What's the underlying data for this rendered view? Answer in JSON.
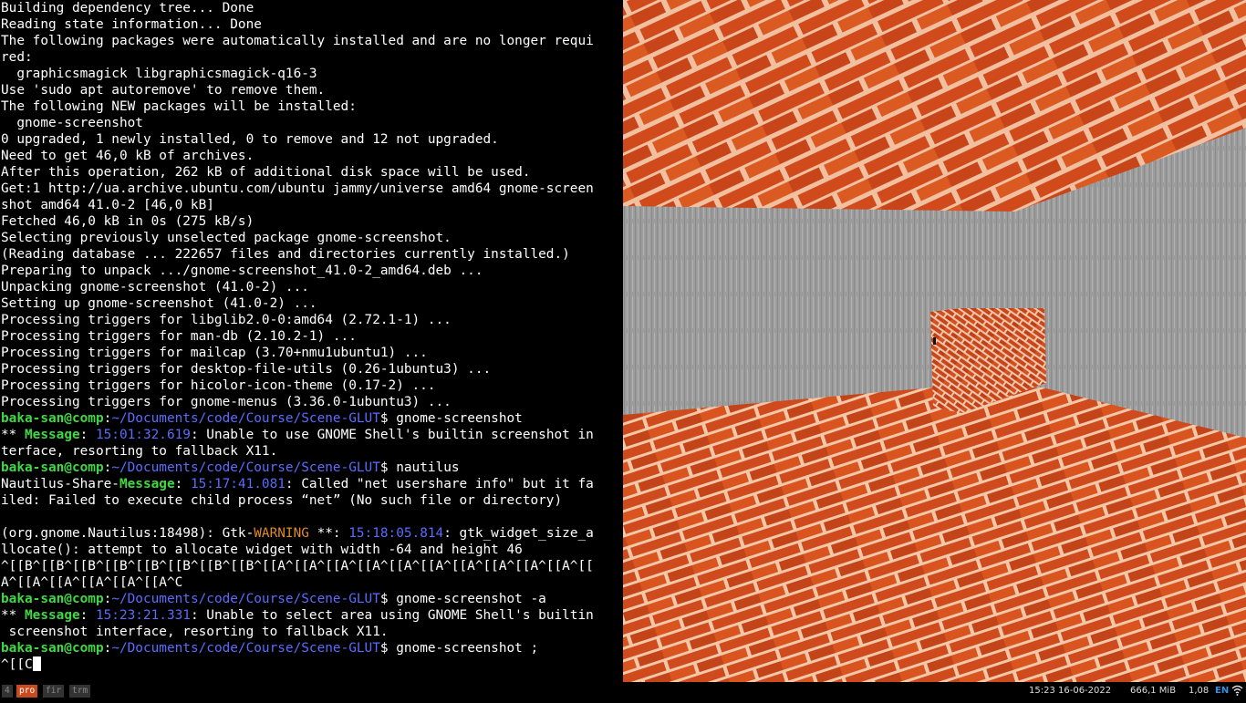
{
  "terminal": {
    "lines": [
      [
        {
          "t": "Building dependency tree... Done"
        }
      ],
      [
        {
          "t": "Reading state information... Done"
        }
      ],
      [
        {
          "t": "The following packages were automatically installed and are no longer requi"
        }
      ],
      [
        {
          "t": "red:"
        }
      ],
      [
        {
          "t": "  graphicsmagick libgraphicsmagick-q16-3"
        }
      ],
      [
        {
          "t": "Use 'sudo apt autoremove' to remove them."
        }
      ],
      [
        {
          "t": "The following NEW packages will be installed:"
        }
      ],
      [
        {
          "t": "  gnome-screenshot"
        }
      ],
      [
        {
          "t": "0 upgraded, 1 newly installed, 0 to remove and 12 not upgraded."
        }
      ],
      [
        {
          "t": "Need to get 46,0 kB of archives."
        }
      ],
      [
        {
          "t": "After this operation, 262 kB of additional disk space will be used."
        }
      ],
      [
        {
          "t": "Get:1 http://ua.archive.ubuntu.com/ubuntu jammy/universe amd64 gnome-screen"
        }
      ],
      [
        {
          "t": "shot amd64 41.0-2 [46,0 kB]"
        }
      ],
      [
        {
          "t": "Fetched 46,0 kB in 0s (275 kB/s)"
        }
      ],
      [
        {
          "t": "Selecting previously unselected package gnome-screenshot."
        }
      ],
      [
        {
          "t": "(Reading database ... 222657 files and directories currently installed.)"
        }
      ],
      [
        {
          "t": "Preparing to unpack .../gnome-screenshot_41.0-2_amd64.deb ..."
        }
      ],
      [
        {
          "t": "Unpacking gnome-screenshot (41.0-2) ..."
        }
      ],
      [
        {
          "t": "Setting up gnome-screenshot (41.0-2) ..."
        }
      ],
      [
        {
          "t": "Processing triggers for libglib2.0-0:amd64 (2.72.1-1) ..."
        }
      ],
      [
        {
          "t": "Processing triggers for man-db (2.10.2-1) ..."
        }
      ],
      [
        {
          "t": "Processing triggers for mailcap (3.70+nmu1ubuntu1) ..."
        }
      ],
      [
        {
          "t": "Processing triggers for desktop-file-utils (0.26-1ubuntu3) ..."
        }
      ],
      [
        {
          "t": "Processing triggers for hicolor-icon-theme (0.17-2) ..."
        }
      ],
      [
        {
          "t": "Processing triggers for gnome-menus (3.36.0-1ubuntu3) ..."
        }
      ],
      [
        {
          "t": "baka-san@comp",
          "c": "g"
        },
        {
          "t": ":"
        },
        {
          "t": "~/Documents/code/Course/Scene-GLUT",
          "c": "b"
        },
        {
          "t": "$ gnome-screenshot"
        }
      ],
      [
        {
          "t": "** "
        },
        {
          "t": "Message",
          "c": "g"
        },
        {
          "t": ": "
        },
        {
          "t": "15:01:32.619",
          "c": "b"
        },
        {
          "t": ": Unable to use GNOME Shell's builtin screenshot in"
        }
      ],
      [
        {
          "t": "terface, resorting to fallback X11."
        }
      ],
      [
        {
          "t": "baka-san@comp",
          "c": "g"
        },
        {
          "t": ":"
        },
        {
          "t": "~/Documents/code/Course/Scene-GLUT",
          "c": "b"
        },
        {
          "t": "$ nautilus"
        }
      ],
      [
        {
          "t": "Nautilus-Share-"
        },
        {
          "t": "Message",
          "c": "g"
        },
        {
          "t": ": "
        },
        {
          "t": "15:17:41.081",
          "c": "b"
        },
        {
          "t": ": Called \"net usershare info\" but it fa"
        }
      ],
      [
        {
          "t": "iled: Failed to execute child process “net” (No such file or directory)"
        }
      ],
      [
        {
          "t": ""
        }
      ],
      [
        {
          "t": "(org.gnome.Nautilus:18498): Gtk-"
        },
        {
          "t": "WARNING",
          "c": "y"
        },
        {
          "t": " **: "
        },
        {
          "t": "15:18:05.814",
          "c": "b"
        },
        {
          "t": ": gtk_widget_size_a"
        }
      ],
      [
        {
          "t": "llocate(): attempt to allocate widget with width -64 and height 46"
        }
      ],
      [
        {
          "t": "^[[B^[[B^[[B^[[B^[[B^[[B^[[B^[[B^[[A^[[A^[[A^[[A^[[A^[[A^[[A^[[A^[[A^[[A^[["
        }
      ],
      [
        {
          "t": "A^[[A^[[A^[[A^[[A^[[A^C"
        }
      ],
      [
        {
          "t": "baka-san@comp",
          "c": "g"
        },
        {
          "t": ":"
        },
        {
          "t": "~/Documents/code/Course/Scene-GLUT",
          "c": "b"
        },
        {
          "t": "$ gnome-screenshot -a"
        }
      ],
      [
        {
          "t": "** "
        },
        {
          "t": "Message",
          "c": "g"
        },
        {
          "t": ": "
        },
        {
          "t": "15:23:21.331",
          "c": "b"
        },
        {
          "t": ": Unable to select area using GNOME Shell's builtin"
        }
      ],
      [
        {
          "t": " screenshot interface, resorting to fallback X11."
        }
      ],
      [
        {
          "t": "baka-san@comp",
          "c": "g"
        },
        {
          "t": ":"
        },
        {
          "t": "~/Documents/code/Course/Scene-GLUT",
          "c": "b"
        },
        {
          "t": "$ gnome-screenshot ;"
        }
      ],
      [
        {
          "t": "^[[C"
        }
      ]
    ]
  },
  "bar": {
    "workspaces": [
      {
        "label": "4",
        "active": false
      },
      {
        "label": "pro",
        "active": true
      },
      {
        "label": "fir",
        "active": false
      },
      {
        "label": "trm",
        "active": false
      }
    ],
    "clock": "15:23 16-06-2022",
    "memory": "666,1 MiB",
    "load": "1,08",
    "layout": "EN"
  },
  "colors": {
    "prompt": "#3fd943",
    "path": "#5a6cff",
    "warning": "#e08a1e",
    "brick": "#d04a1c",
    "mortar": "#f2c8a8",
    "wall": "#9a9a9a"
  }
}
